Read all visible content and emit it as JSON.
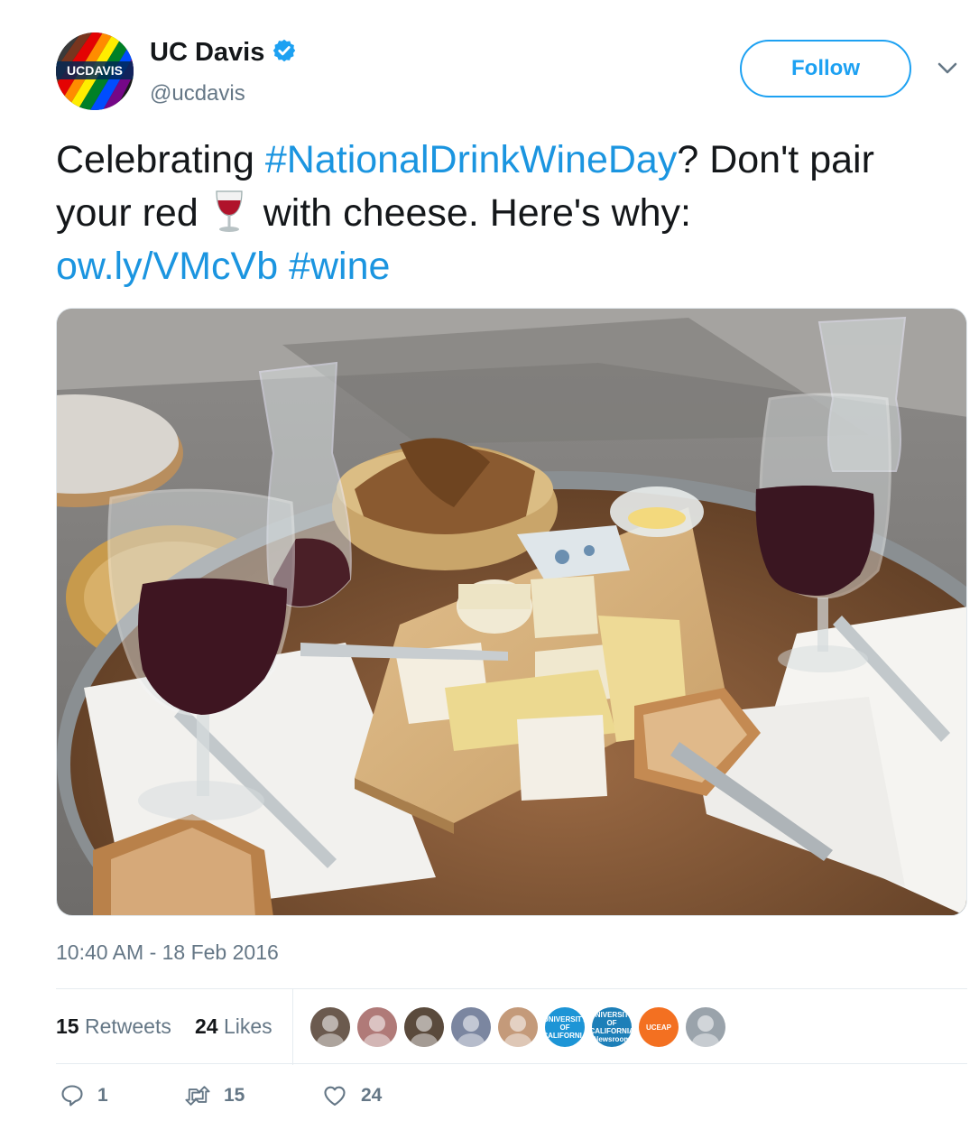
{
  "author": {
    "display_name": "UC Davis",
    "handle": "@ucdavis",
    "verified": true,
    "avatar_text": "UCDAVIS"
  },
  "follow_label": "Follow",
  "tweet": {
    "text_1": "Celebrating ",
    "hashtag_1": "#NationalDrinkWineDay",
    "text_2": "? Don't pair your red",
    "text_3": "with cheese. Here's why:",
    "link": "ow.ly/VMcVb",
    "hashtag_2": "#wine"
  },
  "timestamp": "10:40 AM - 18 Feb 2016",
  "stats": {
    "retweets_count": "15",
    "retweets_label": "Retweets",
    "likes_count": "24",
    "likes_label": "Likes"
  },
  "likers": [
    {
      "name": "liker-1",
      "color": "#6b5a4e"
    },
    {
      "name": "liker-2",
      "color": "#b07a78"
    },
    {
      "name": "liker-3",
      "color": "#5a4a3c"
    },
    {
      "name": "liker-4",
      "color": "#7b86a0"
    },
    {
      "name": "liker-5",
      "color": "#c49a7a"
    },
    {
      "name": "liker-6",
      "color": "#1d95d6",
      "label": "UNIVERSITY OF CALIFORNIA"
    },
    {
      "name": "liker-7",
      "color": "#1d7fb8",
      "label": "UNIVERSITY OF CALIFORNIA Newsroom"
    },
    {
      "name": "liker-8",
      "color": "#f37021",
      "label": "UCEAP"
    },
    {
      "name": "liker-9",
      "color": "#9aa3ab"
    }
  ],
  "actions": {
    "reply_count": "1",
    "retweet_count": "15",
    "like_count": "24"
  },
  "colors": {
    "accent": "#1da1f2",
    "link": "#1b95e0",
    "muted": "#657786",
    "text": "#14171a"
  }
}
